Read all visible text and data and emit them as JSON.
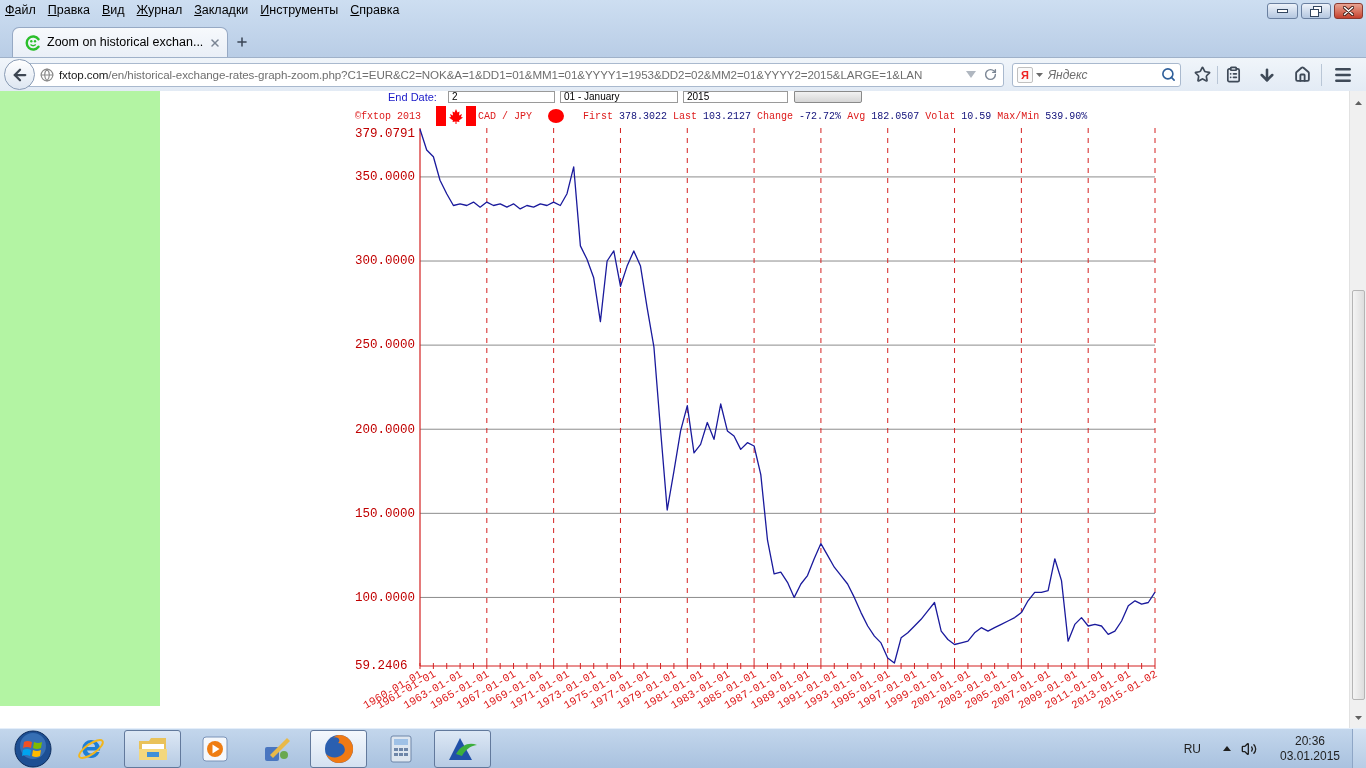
{
  "menu_bar": {
    "items": [
      "Файл",
      "Правка",
      "Вид",
      "Журнал",
      "Закладки",
      "Инструменты",
      "Справка"
    ]
  },
  "tabs": [
    {
      "title": "Zoom on historical exchan...",
      "selected": true
    }
  ],
  "address_bar": {
    "host": "fxtop.com",
    "path": "/en/historical-exchange-rates-graph-zoom.php?C1=EUR&C2=NOK&A=1&DD1=01&MM1=01&YYYY1=1953&DD2=02&MM2=01&YYYY2=2015&LARGE=1&LAN"
  },
  "search_bar": {
    "engine_logo": "Я",
    "placeholder": "Яндекс"
  },
  "page": {
    "date_form": {
      "label": "End Date:",
      "day": "2",
      "month": "01 - January",
      "year": "2015"
    },
    "chart_header": {
      "credit": "©fxtop 2013",
      "stats": [
        {
          "label": "First",
          "value": "378.3022"
        },
        {
          "label": "Last",
          "value": "103.2127"
        },
        {
          "label": "Change",
          "value": "-72.72%"
        },
        {
          "label": "Avg",
          "value": "182.0507"
        },
        {
          "label": "Volat",
          "value": "10.59"
        },
        {
          "label": "Max/Min",
          "value": "539.90%"
        }
      ]
    },
    "chart_data": {
      "type": "line",
      "grid": true,
      "categories": [
        "1960-01-01",
        null,
        "1961-01-01",
        null,
        null,
        null,
        "1963-01-01",
        null,
        null,
        null,
        "1965-01-01",
        null,
        null,
        null,
        "1967-01-01",
        null,
        null,
        null,
        "1969-01-01",
        null,
        null,
        null,
        "1971-01-01",
        null,
        null,
        null,
        "1973-01-01",
        null,
        null,
        null,
        "1975-01-01",
        null,
        null,
        null,
        "1977-01-01",
        null,
        null,
        null,
        "1979-01-01",
        null,
        null,
        null,
        "1981-01-01",
        null,
        null,
        null,
        "1983-01-01",
        null,
        null,
        null,
        "1985-01-01",
        null,
        null,
        null,
        "1987-01-01",
        null,
        null,
        null,
        "1989-01-01",
        null,
        null,
        null,
        "1991-01-01",
        null,
        null,
        null,
        "1993-01-01",
        null,
        null,
        null,
        "1995-01-01",
        null,
        null,
        null,
        "1997-01-01",
        null,
        null,
        null,
        "1999-01-01",
        null,
        null,
        null,
        "2001-01-01",
        null,
        null,
        null,
        "2003-01-01",
        null,
        null,
        null,
        "2005-01-01",
        null,
        null,
        null,
        "2007-01-01",
        null,
        null,
        null,
        "2009-01-01",
        null,
        null,
        null,
        "2011-01-01",
        null,
        null,
        null,
        "2013-01-01",
        null,
        null,
        null,
        "2015-01-02"
      ],
      "series": [
        {
          "name": "CAD / JPY",
          "color": "#1a1a9c",
          "values": [
            378.3,
            366,
            362,
            348,
            340,
            333,
            334,
            333,
            335,
            332,
            335,
            333,
            334,
            332,
            334,
            331,
            333,
            332,
            334,
            333,
            335,
            333,
            340,
            356,
            309,
            301,
            290,
            264,
            300,
            306,
            285,
            297,
            306,
            297,
            272,
            249,
            200,
            152,
            175,
            199,
            214,
            186,
            191,
            204,
            194,
            215,
            199,
            196,
            188,
            192,
            190,
            173,
            134,
            114,
            115,
            109,
            100,
            108,
            113,
            123,
            132,
            125,
            118,
            113,
            108,
            100,
            91,
            83,
            77,
            73,
            64,
            61,
            76,
            79,
            83,
            87,
            92,
            97,
            80,
            75,
            72,
            73,
            74,
            79,
            82,
            80,
            82,
            84,
            86,
            88,
            91,
            98,
            103,
            103,
            104,
            123,
            110,
            74,
            84,
            88,
            83,
            84,
            83,
            78,
            80,
            86,
            95,
            98,
            96,
            97,
            103.2
          ]
        }
      ],
      "ylim": [
        59.2406,
        379.0791
      ],
      "yticks": [
        {
          "value": 59.2406,
          "label": "59.2406"
        },
        {
          "value": 100,
          "label": "100.0000"
        },
        {
          "value": 150,
          "label": "150.0000"
        },
        {
          "value": 200,
          "label": "200.0000"
        },
        {
          "value": 250,
          "label": "250.0000"
        },
        {
          "value": 300,
          "label": "300.0000"
        },
        {
          "value": 350,
          "label": "350.0000"
        },
        {
          "value": 379.0791,
          "label": "379.0791"
        }
      ]
    }
  },
  "taskbar": {
    "apps": [
      {
        "kind": "e-globe",
        "running": false,
        "selected": false
      },
      {
        "kind": "folder",
        "running": true,
        "selected": false
      },
      {
        "kind": "media",
        "running": false,
        "selected": false
      },
      {
        "kind": "tools",
        "running": false,
        "selected": false
      },
      {
        "kind": "fox",
        "running": true,
        "selected": true
      },
      {
        "kind": "calculator",
        "running": false,
        "selected": false
      },
      {
        "kind": "chart",
        "running": true,
        "selected": false
      }
    ],
    "language": "RU",
    "time": "20:36",
    "date": "03.01.2015"
  }
}
